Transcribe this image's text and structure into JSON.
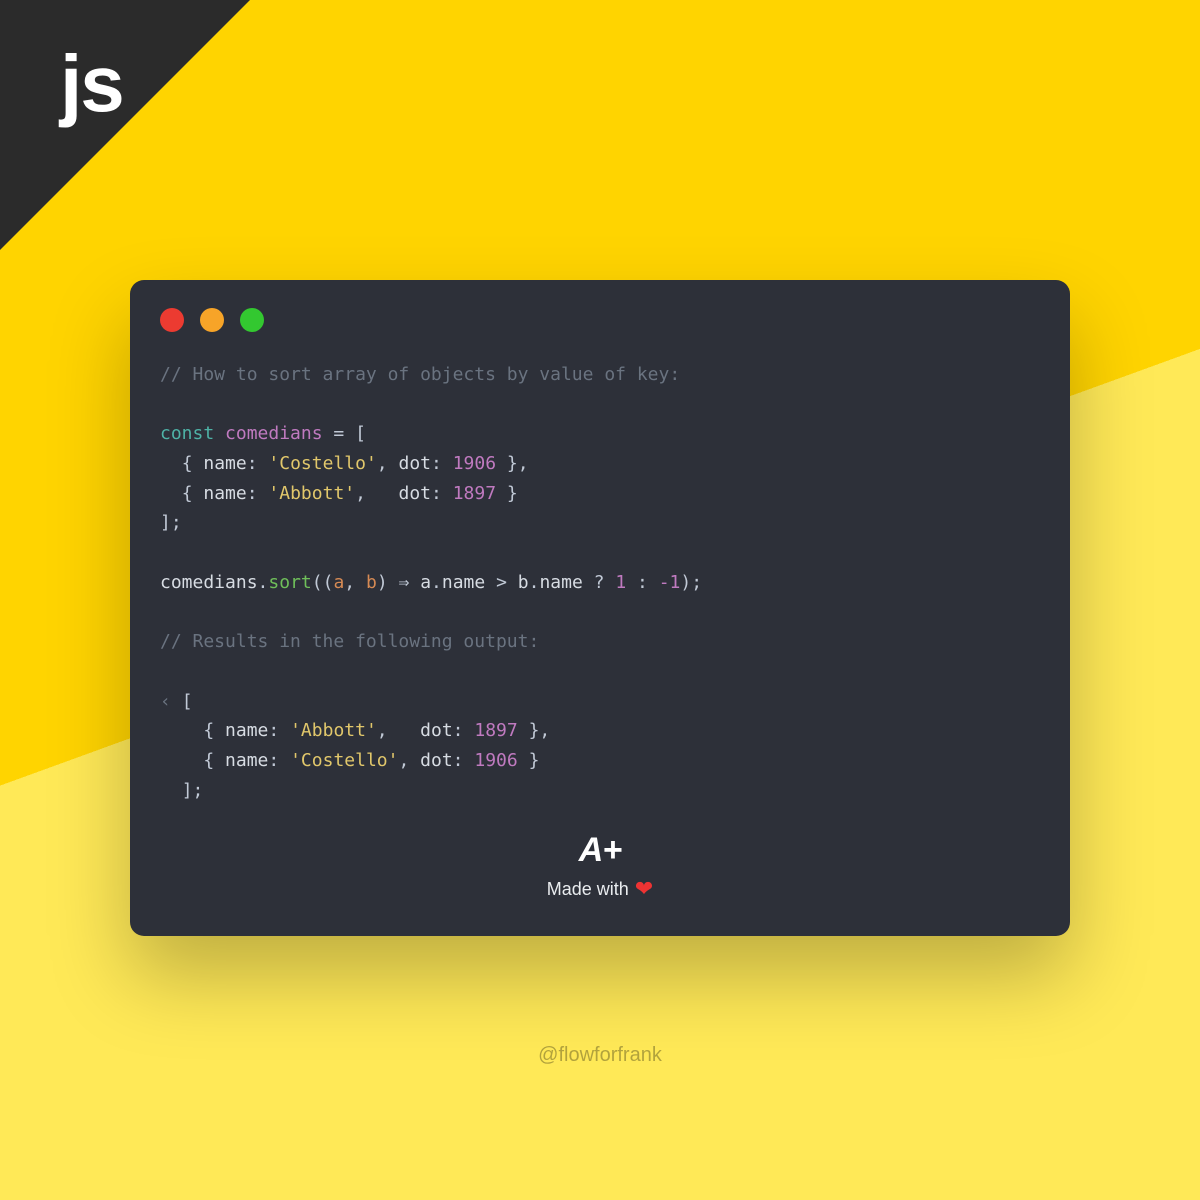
{
  "corner_label": "js",
  "code": {
    "comment_1": "// How to sort array of objects by value of key:",
    "kw_const": "const",
    "var_name": "comedians",
    "array_open": " = [",
    "row1": {
      "prop1": "name",
      "val1": "'Costello'",
      "prop2": "dot",
      "val2": "1906"
    },
    "row2": {
      "prop1": "name",
      "val1": "'Abbott'",
      "prop2": "dot",
      "val2": "1897"
    },
    "array_close": "];",
    "sort_line": {
      "obj": "comedians",
      "fn": "sort",
      "params": "(a, b)",
      "a": "a",
      "b": "b",
      "prop": "name",
      "tern_true": "1",
      "tern_false": "-1"
    },
    "comment_2": "// Results in the following output:",
    "out_prefix": "‹ ",
    "out_open": "[",
    "out1": {
      "prop1": "name",
      "val1": "'Abbott'",
      "prop2": "dot",
      "val2": "1897"
    },
    "out2": {
      "prop1": "name",
      "val1": "'Costello'",
      "prop2": "dot",
      "val2": "1906"
    },
    "out_close": "];"
  },
  "footer": {
    "logo": "A+",
    "madewith": "Made with"
  },
  "handle": "@flowforfrank",
  "chart_data": {
    "type": "table",
    "title": "How to sort array of objects by value of key",
    "input": [
      {
        "name": "Costello",
        "dot": 1906
      },
      {
        "name": "Abbott",
        "dot": 1897
      }
    ],
    "operation": "comedians.sort((a, b) => a.name > b.name ? 1 : -1)",
    "output": [
      {
        "name": "Abbott",
        "dot": 1897
      },
      {
        "name": "Costello",
        "dot": 1906
      }
    ],
    "language": "javascript"
  }
}
